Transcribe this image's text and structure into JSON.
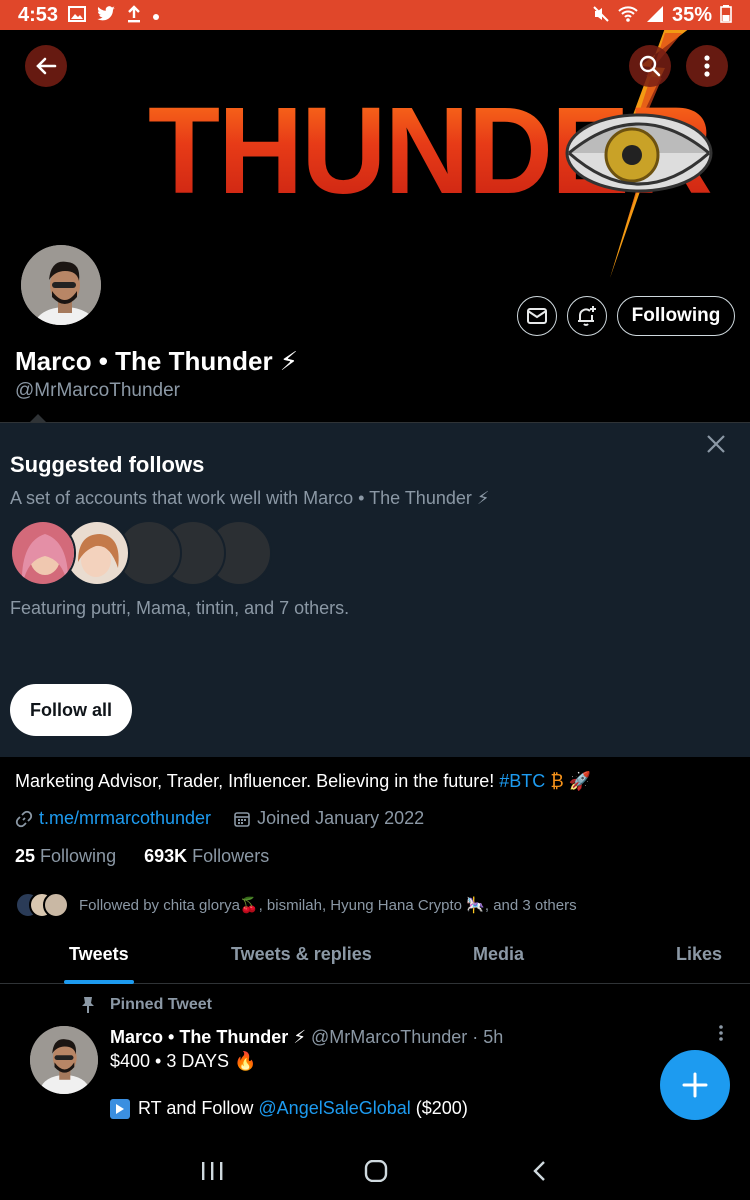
{
  "status_bar": {
    "time": "4:53",
    "battery": "35%"
  },
  "banner": {
    "title": "THUNDER"
  },
  "profile": {
    "name": "Marco • The Thunder ⚡",
    "handle": "@MrMarcoThunder",
    "following_button": "Following"
  },
  "suggested": {
    "title": "Suggested follows",
    "description": "A set of accounts that work well with Marco • The Thunder ⚡",
    "featuring": "Featuring putri, Mama, tintin, and 7 others.",
    "follow_all": "Follow all"
  },
  "bio": {
    "text": "Marketing Advisor, Trader, Influencer. Believing in the future! ",
    "hashtag": "#BTC",
    "emojis": "₿ 🚀",
    "link": "t.me/mrmarcothunder",
    "joined": "Joined January 2022"
  },
  "stats": {
    "following_count": "25",
    "following_label": "Following",
    "followers_count": "693K",
    "followers_label": "Followers"
  },
  "followed_by": "Followed by chita glorya🍒, bismilah, Hyung Hana Crypto 🎠, and 3 others",
  "tabs": [
    "Tweets",
    "Tweets & replies",
    "Media",
    "Likes"
  ],
  "tweet": {
    "pinned_label": "Pinned Tweet",
    "author": "Marco • The Thunder ⚡",
    "handle_time": "@MrMarcoThunder · 5h",
    "line1": "$400 • 3 DAYS 🔥",
    "line2_pre": "RT and Follow ",
    "mention": "@AngelSaleGlobal",
    "line2_post": " ($200)"
  },
  "colors": {
    "accent": "#1d9bf0",
    "status_bar": "#e0472a",
    "panel": "#15202b"
  }
}
